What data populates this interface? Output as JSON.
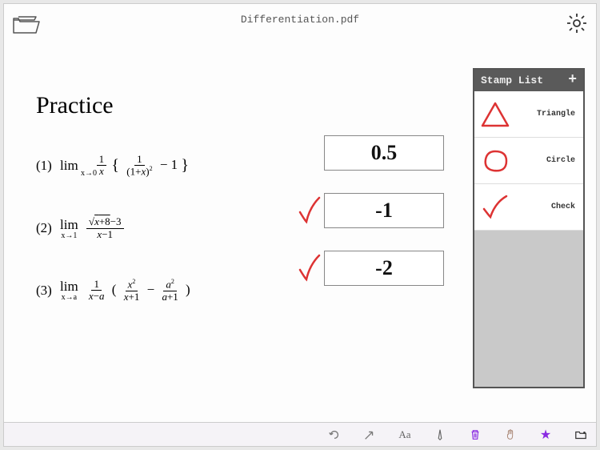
{
  "header": {
    "title": "Differentiation.pdf"
  },
  "page": {
    "heading": "Practice"
  },
  "problems": [
    {
      "num": "(1)",
      "limsub": "x→0",
      "answer": "0.5",
      "checked": false
    },
    {
      "num": "(2)",
      "limsub": "x→1",
      "answer": "-1",
      "checked": true
    },
    {
      "num": "(3)",
      "limsub": "x→a",
      "answer": "-2",
      "checked": true
    }
  ],
  "stamp_panel": {
    "title": "Stamp List",
    "items": [
      {
        "label": "Triangle"
      },
      {
        "label": "Circle"
      },
      {
        "label": "Check"
      }
    ]
  },
  "toolbar": {
    "undo": "↶",
    "arrow": "↖",
    "text": "Aa",
    "pen": "✎",
    "trash": "🗑",
    "hand": "☝",
    "star": "★",
    "folder": "📁"
  }
}
